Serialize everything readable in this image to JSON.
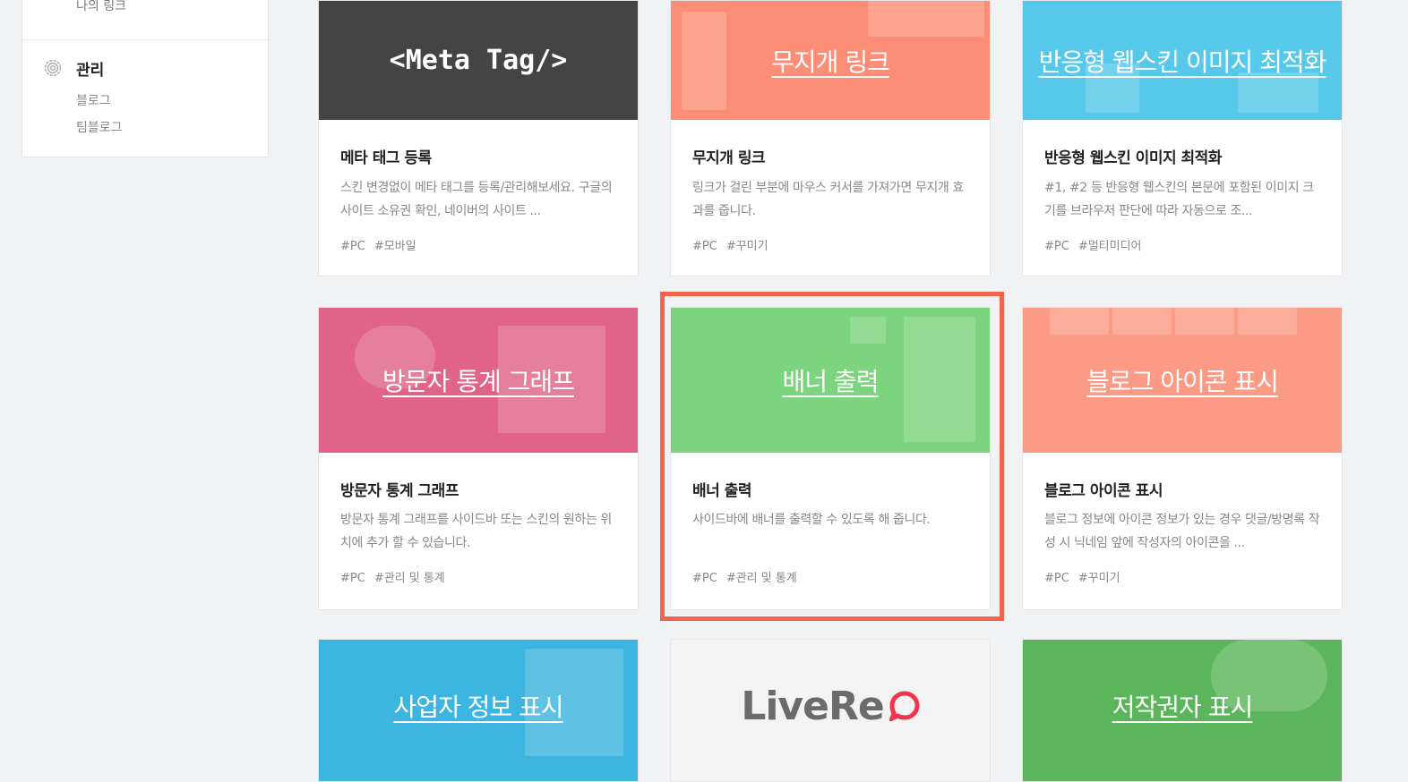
{
  "sidebar": {
    "prev_item": "나의 링크",
    "section_title": "관리",
    "items": [
      "블로그",
      "팀블로그"
    ],
    "icon": "gear-icon"
  },
  "cards": [
    {
      "thumb_title": "<Meta Tag/>",
      "thumb_color": "#444444",
      "title": "메타 태그 등록",
      "desc": "스킨 변경없이 메타 태그를 등록/관리해보세요. 구글의 사이트 소유권 확인, 네이버의 사이트 ...",
      "tags": [
        "#PC",
        "#모바일"
      ]
    },
    {
      "thumb_title": "무지개 링크",
      "thumb_color": "#fc8e77",
      "title": "무지개 링크",
      "desc": "링크가 걸린 부분에 마우스 커서를 가져가면 무지개 효과를 줍니다.",
      "tags": [
        "#PC",
        "#꾸미기"
      ]
    },
    {
      "thumb_title": "반응형 웹스킨 이미지 최적화",
      "thumb_color": "#56c8ea",
      "title": "반응형 웹스킨 이미지 최적화",
      "desc": "#1, #2 등 반응형 웹스킨의 본문에 포함된 이미지 크기를 브라우저 판단에 따라 자동으로 조...",
      "tags": [
        "#PC",
        "#멀티미디어"
      ]
    },
    {
      "thumb_title": "방문자 통계 그래프",
      "thumb_color": "#e06389",
      "title": "방문자 통계 그래프",
      "desc": "방문자 통계 그래프를 사이드바 또는 스킨의 원하는 위치에 추가 할 수 있습니다.",
      "tags": [
        "#PC",
        "#관리 및 통계"
      ]
    },
    {
      "thumb_title": "배너 출력",
      "thumb_color": "#7dd47f",
      "title": "배너 출력",
      "desc": "사이드바에 배너를 출력할 수 있도록 해 줍니다.",
      "tags": [
        "#PC",
        "#관리 및 통계"
      ]
    },
    {
      "thumb_title": "블로그 아이콘 표시",
      "thumb_color": "#fb9a85",
      "title": "블로그 아이콘 표시",
      "desc": "블로그 정보에 아이콘 정보가 있는 경우 댓글/방명록 작성 시 닉네임 앞에 작성자의 아이콘을 ...",
      "tags": [
        "#PC",
        "#꾸미기"
      ]
    },
    {
      "thumb_title": "사업자 정보 표시",
      "thumb_color": "#3cb5e0"
    },
    {
      "thumb_title": "LiveRe",
      "thumb_color": "#f3f3f4"
    },
    {
      "thumb_title": "저작권자 표시",
      "thumb_color": "#5bb65b"
    }
  ],
  "accent": "#f2644c"
}
